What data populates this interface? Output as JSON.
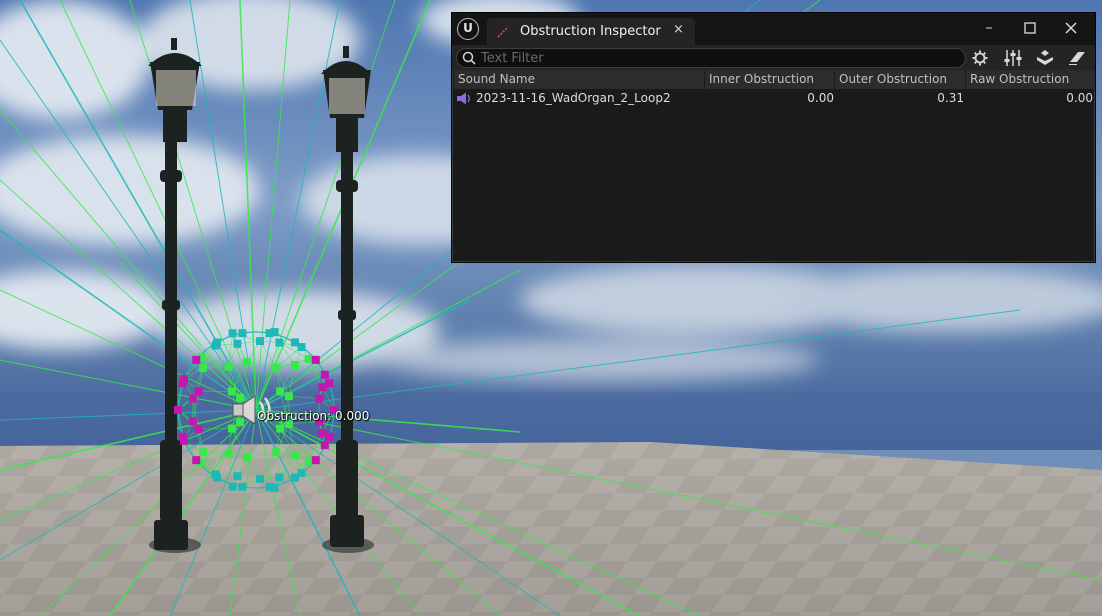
{
  "inspector": {
    "tab_title": "Obstruction Inspector",
    "close_glyph": "×",
    "window_controls": {
      "minimize": "–",
      "maximize": "☐",
      "close": "✕"
    },
    "search": {
      "placeholder": "Text Filter",
      "value": ""
    },
    "toolbar_icons": [
      "settings-icon",
      "sliders-icon",
      "actor-filter-icon",
      "eraser-icon"
    ],
    "columns": [
      "Sound Name",
      "Inner Obstruction",
      "Outer Obstruction",
      "Raw Obstruction"
    ],
    "rows": [
      {
        "name": "2023-11-16_WadOrgan_2_Loop2",
        "inner": "0.00",
        "outer": "0.31",
        "raw": "0.00"
      }
    ]
  },
  "viewport": {
    "obstruction_label": "Obstruction: 0.000"
  },
  "colors": {
    "accent_tab_icon": "#e0305a",
    "speaker_icon": "#8d6bd8",
    "debug_green": "#37e84a",
    "debug_cyan": "#1fb8b8",
    "debug_magenta": "#c417b0"
  }
}
